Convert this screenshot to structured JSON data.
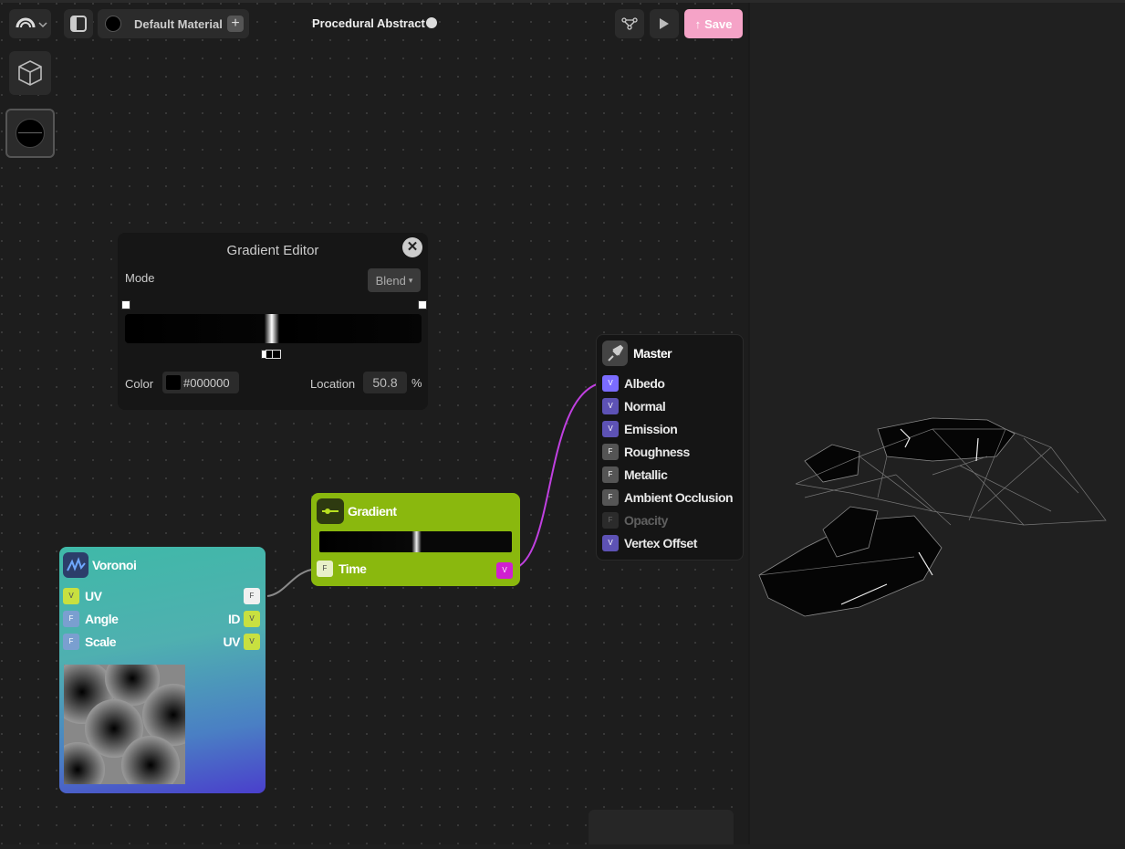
{
  "toolbar": {
    "material_label": "Default Material",
    "project_title": "Procedural Abstract",
    "save_label": "Save"
  },
  "gradient_editor": {
    "title": "Gradient Editor",
    "mode_label": "Mode",
    "mode_value": "Blend",
    "color_label": "Color",
    "color_hex": "#000000",
    "location_label": "Location",
    "location_value": "50.8",
    "percent_sign": "%"
  },
  "nodes": {
    "master": {
      "title": "Master",
      "inputs": [
        {
          "badge": "V",
          "label": "Albedo"
        },
        {
          "badge": "V",
          "label": "Normal"
        },
        {
          "badge": "V",
          "label": "Emission"
        },
        {
          "badge": "F",
          "label": "Roughness"
        },
        {
          "badge": "F",
          "label": "Metallic"
        },
        {
          "badge": "F",
          "label": "Ambient Occlusion"
        },
        {
          "badge": "F",
          "label": "Opacity"
        },
        {
          "badge": "V",
          "label": "Vertex Offset"
        }
      ]
    },
    "gradient": {
      "title": "Gradient",
      "input_badge": "F",
      "input_label": "Time",
      "output_badge": "V"
    },
    "voronoi": {
      "title": "Voronoi",
      "inputs": [
        {
          "badge": "V",
          "label": "UV"
        },
        {
          "badge": "F",
          "label": "Angle"
        },
        {
          "badge": "F",
          "label": "Scale"
        }
      ],
      "outputs": [
        {
          "badge": "F",
          "label": ""
        },
        {
          "badge": "V",
          "label": "ID"
        },
        {
          "badge": "V",
          "label": "UV"
        }
      ]
    }
  },
  "colors": {
    "save_button": "#f5a3c7",
    "gradient_node": "#8ab80e",
    "vector_badge": "#6a5acd",
    "float_badge": "#555555",
    "connection_albedo": "#c040e0"
  },
  "icons": [
    "logo-icon",
    "chevron-down-icon",
    "panel-toggle-icon",
    "plus-icon",
    "globe-icon",
    "graph-icon",
    "play-icon",
    "upload-icon",
    "cube-icon",
    "sphere-icon",
    "close-icon",
    "plug-icon",
    "gradient-icon",
    "voronoi-icon"
  ]
}
